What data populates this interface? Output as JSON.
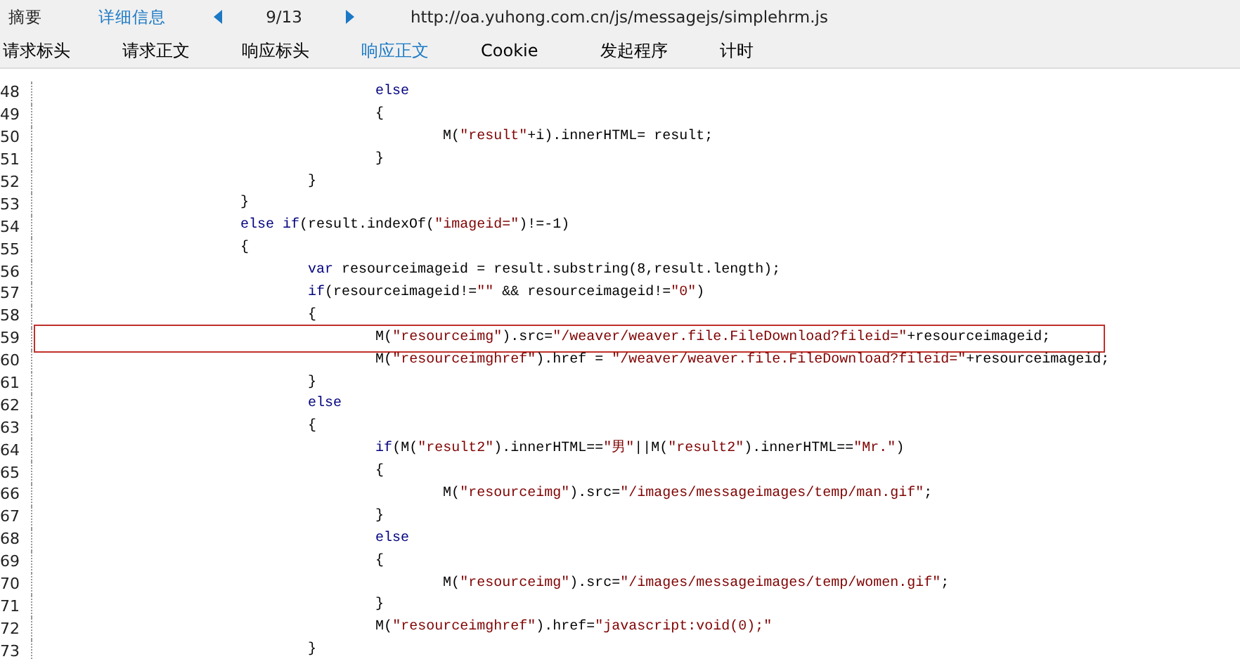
{
  "top_tabs": [
    {
      "label": "摘要",
      "selected": false
    },
    {
      "label": "详细信息",
      "selected": true
    }
  ],
  "pager": {
    "position": "9/13",
    "url": "http://oa.yuhong.com.cn/js/messagejs/simplehrm.js"
  },
  "sub_tabs": [
    {
      "label": "请求标头",
      "selected": false
    },
    {
      "label": "请求正文",
      "selected": false
    },
    {
      "label": "响应标头",
      "selected": false
    },
    {
      "label": "响应正文",
      "selected": true
    },
    {
      "label": "Cookie",
      "selected": false
    },
    {
      "label": "发起程序",
      "selected": false
    },
    {
      "label": "计时",
      "selected": false
    }
  ],
  "code_lines": [
    {
      "number": "48",
      "highlighted": false,
      "tokens": [
        {
          "kind": "keyword",
          "text": "\t\t\t\t\telse"
        }
      ]
    },
    {
      "number": "49",
      "highlighted": false,
      "tokens": [
        {
          "kind": "plain",
          "text": "\t\t\t\t\t{"
        }
      ]
    },
    {
      "number": "50",
      "highlighted": false,
      "tokens": [
        {
          "kind": "plain",
          "text": "\t\t\t\t\t\tM("
        },
        {
          "kind": "string",
          "text": "\"result\""
        },
        {
          "kind": "plain",
          "text": "+i).innerHTML= result;"
        }
      ]
    },
    {
      "number": "51",
      "highlighted": false,
      "tokens": [
        {
          "kind": "plain",
          "text": "\t\t\t\t\t}"
        }
      ]
    },
    {
      "number": "52",
      "highlighted": false,
      "tokens": [
        {
          "kind": "plain",
          "text": "\t\t\t\t}"
        }
      ]
    },
    {
      "number": "53",
      "highlighted": false,
      "tokens": [
        {
          "kind": "plain",
          "text": "\t\t\t}"
        }
      ]
    },
    {
      "number": "54",
      "highlighted": false,
      "tokens": [
        {
          "kind": "keyword",
          "text": "\t\t\telse if"
        },
        {
          "kind": "plain",
          "text": "(result.indexOf("
        },
        {
          "kind": "string",
          "text": "\"imageid=\""
        },
        {
          "kind": "plain",
          "text": ")!=-1)"
        }
      ]
    },
    {
      "number": "55",
      "highlighted": false,
      "tokens": [
        {
          "kind": "plain",
          "text": "\t\t\t{"
        }
      ]
    },
    {
      "number": "56",
      "highlighted": false,
      "tokens": [
        {
          "kind": "keyword",
          "text": "\t\t\t\tvar"
        },
        {
          "kind": "plain",
          "text": " resourceimageid = result.substring(8,result.length);"
        }
      ]
    },
    {
      "number": "57",
      "highlighted": false,
      "tokens": [
        {
          "kind": "keyword",
          "text": "\t\t\t\tif"
        },
        {
          "kind": "plain",
          "text": "(resourceimageid!="
        },
        {
          "kind": "string",
          "text": "\"\""
        },
        {
          "kind": "plain",
          "text": " && resourceimageid!="
        },
        {
          "kind": "string",
          "text": "\"0\""
        },
        {
          "kind": "plain",
          "text": ")"
        }
      ]
    },
    {
      "number": "58",
      "highlighted": false,
      "tokens": [
        {
          "kind": "plain",
          "text": "\t\t\t\t{"
        }
      ]
    },
    {
      "number": "59",
      "highlighted": true,
      "tokens": [
        {
          "kind": "plain",
          "text": "\t\t\t\t\tM("
        },
        {
          "kind": "string",
          "text": "\"resourceimg\""
        },
        {
          "kind": "plain",
          "text": ").src="
        },
        {
          "kind": "string",
          "text": "\"/weaver/weaver.file.FileDownload?fileid=\""
        },
        {
          "kind": "plain",
          "text": "+resourceimageid;"
        }
      ]
    },
    {
      "number": "60",
      "highlighted": false,
      "tokens": [
        {
          "kind": "plain",
          "text": "\t\t\t\t\tM("
        },
        {
          "kind": "string",
          "text": "\"resourceimghref\""
        },
        {
          "kind": "plain",
          "text": ").href = "
        },
        {
          "kind": "string",
          "text": "\"/weaver/weaver.file.FileDownload?fileid=\""
        },
        {
          "kind": "plain",
          "text": "+resourceimageid;"
        }
      ]
    },
    {
      "number": "61",
      "highlighted": false,
      "tokens": [
        {
          "kind": "plain",
          "text": "\t\t\t\t}"
        }
      ]
    },
    {
      "number": "62",
      "highlighted": false,
      "tokens": [
        {
          "kind": "keyword",
          "text": "\t\t\t\telse"
        }
      ]
    },
    {
      "number": "63",
      "highlighted": false,
      "tokens": [
        {
          "kind": "plain",
          "text": "\t\t\t\t{"
        }
      ]
    },
    {
      "number": "64",
      "highlighted": false,
      "tokens": [
        {
          "kind": "keyword",
          "text": "\t\t\t\t\tif"
        },
        {
          "kind": "plain",
          "text": "(M("
        },
        {
          "kind": "string",
          "text": "\"result2\""
        },
        {
          "kind": "plain",
          "text": ").innerHTML=="
        },
        {
          "kind": "string",
          "text": "\"男\""
        },
        {
          "kind": "plain",
          "text": "||M("
        },
        {
          "kind": "string",
          "text": "\"result2\""
        },
        {
          "kind": "plain",
          "text": ").innerHTML=="
        },
        {
          "kind": "string",
          "text": "\"Mr.\""
        },
        {
          "kind": "plain",
          "text": ")"
        }
      ]
    },
    {
      "number": "65",
      "highlighted": false,
      "tokens": [
        {
          "kind": "plain",
          "text": "\t\t\t\t\t{"
        }
      ]
    },
    {
      "number": "66",
      "highlighted": false,
      "tokens": [
        {
          "kind": "plain",
          "text": "\t\t\t\t\t\tM("
        },
        {
          "kind": "string",
          "text": "\"resourceimg\""
        },
        {
          "kind": "plain",
          "text": ").src="
        },
        {
          "kind": "string",
          "text": "\"/images/messageimages/temp/man.gif\""
        },
        {
          "kind": "plain",
          "text": ";"
        }
      ]
    },
    {
      "number": "67",
      "highlighted": false,
      "tokens": [
        {
          "kind": "plain",
          "text": "\t\t\t\t\t}"
        }
      ]
    },
    {
      "number": "68",
      "highlighted": false,
      "tokens": [
        {
          "kind": "keyword",
          "text": "\t\t\t\t\telse"
        }
      ]
    },
    {
      "number": "69",
      "highlighted": false,
      "tokens": [
        {
          "kind": "plain",
          "text": "\t\t\t\t\t{"
        }
      ]
    },
    {
      "number": "70",
      "highlighted": false,
      "tokens": [
        {
          "kind": "plain",
          "text": "\t\t\t\t\t\tM("
        },
        {
          "kind": "string",
          "text": "\"resourceimg\""
        },
        {
          "kind": "plain",
          "text": ").src="
        },
        {
          "kind": "string",
          "text": "\"/images/messageimages/temp/women.gif\""
        },
        {
          "kind": "plain",
          "text": ";"
        }
      ]
    },
    {
      "number": "71",
      "highlighted": false,
      "tokens": [
        {
          "kind": "plain",
          "text": "\t\t\t\t\t}"
        }
      ]
    },
    {
      "number": "72",
      "highlighted": false,
      "tokens": [
        {
          "kind": "plain",
          "text": "\t\t\t\t\tM("
        },
        {
          "kind": "string",
          "text": "\"resourceimghref\""
        },
        {
          "kind": "plain",
          "text": ").href="
        },
        {
          "kind": "string",
          "text": "\"javascript:void(0);\""
        }
      ]
    },
    {
      "number": "73",
      "highlighted": false,
      "tokens": [
        {
          "kind": "plain",
          "text": "\t\t\t\t}"
        }
      ]
    }
  ]
}
